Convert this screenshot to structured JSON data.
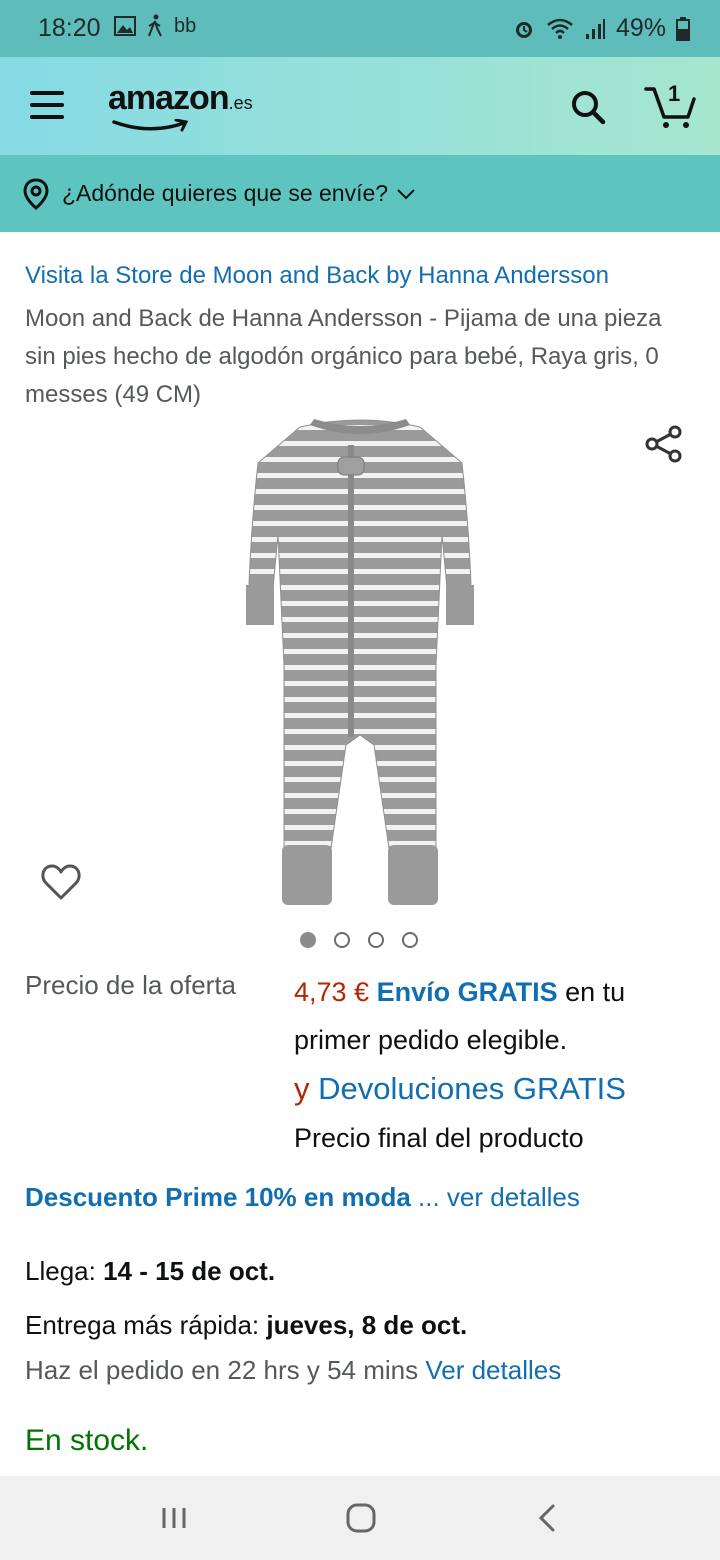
{
  "status_bar": {
    "time": "18:20",
    "extra_text": "bb",
    "battery": "49%"
  },
  "header": {
    "logo_text": "amazon",
    "logo_suffix": ".es",
    "cart_count": "1"
  },
  "location": {
    "text": "¿Adónde quieres que se envíe?"
  },
  "product": {
    "store_link": "Visita la Store de Moon and Back by Hanna Andersson",
    "title": "Moon and Back de Hanna Andersson - Pijama de una pieza sin pies hecho de algodón orgánico para bebé, Raya gris, 0 messes (49 CM)",
    "image_count": 4,
    "active_image": 1
  },
  "pricing": {
    "label": "Precio de la oferta",
    "price": "4,73 €",
    "free_shipping": "Envío GRATIS",
    "shipping_rest": " en tu primer pedido elegible.",
    "returns_prefix": "y",
    "returns": " Devoluciones GRATIS",
    "final_price_note": "Precio final del producto"
  },
  "prime": {
    "discount": "Descuento Prime 10% en moda",
    "details": " ... ver detalles"
  },
  "delivery": {
    "arrives_label": "Llega: ",
    "arrives_dates": "14 - 15 de oct.",
    "fastest_label": "Entrega más rápida: ",
    "fastest_date": "jueves, 8 de oct.",
    "order_within": "Haz el pedido en 22 hrs y 54 mins ",
    "details_link": "Ver detalles"
  },
  "stock": {
    "status": "En stock."
  },
  "colors": {
    "link": "#116eb1",
    "price": "#b12704",
    "in_stock": "#007600",
    "status_bar": "#5ebdba",
    "location_bar": "#5ec4bf"
  }
}
